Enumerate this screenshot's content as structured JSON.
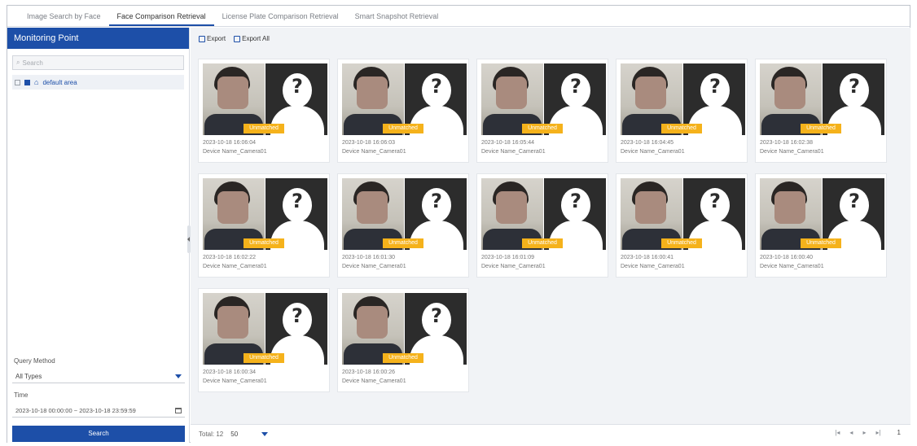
{
  "tabs": [
    {
      "label": "Image Search by Face"
    },
    {
      "label": "Face Comparison Retrieval"
    },
    {
      "label": "License Plate Comparison Retrieval"
    },
    {
      "label": "Smart Snapshot Retrieval"
    }
  ],
  "sidebar": {
    "title": "Monitoring Point",
    "search_placeholder": "Search",
    "tree_item": "default area",
    "query_method_label": "Query Method",
    "query_method_value": "All Types",
    "time_label": "Time",
    "time_range": "2023-10-18 00:00:00  ~  2023-10-18 23:59:59",
    "search_button": "Search"
  },
  "toolbar": {
    "export": "Export",
    "export_all": "Export All"
  },
  "badge_text": "Unmatched",
  "cards": [
    {
      "time": "2023-10-18 16:06:04",
      "device": "Device Name_Camera01"
    },
    {
      "time": "2023-10-18 16:06:03",
      "device": "Device Name_Camera01"
    },
    {
      "time": "2023-10-18 16:05:44",
      "device": "Device Name_Camera01"
    },
    {
      "time": "2023-10-18 16:04:45",
      "device": "Device Name_Camera01"
    },
    {
      "time": "2023-10-18 16:02:38",
      "device": "Device Name_Camera01"
    },
    {
      "time": "2023-10-18 16:02:22",
      "device": "Device Name_Camera01"
    },
    {
      "time": "2023-10-18 16:01:30",
      "device": "Device Name_Camera01"
    },
    {
      "time": "2023-10-18 16:01:09",
      "device": "Device Name_Camera01"
    },
    {
      "time": "2023-10-18 16:00:41",
      "device": "Device Name_Camera01"
    },
    {
      "time": "2023-10-18 16:00:40",
      "device": "Device Name_Camera01"
    },
    {
      "time": "2023-10-18 16:00:34",
      "device": "Device Name_Camera01"
    },
    {
      "time": "2023-10-18 16:00:26",
      "device": "Device Name_Camera01"
    }
  ],
  "footer": {
    "total": "Total: 12",
    "page_size": "50",
    "pager": {
      "first": "|◂",
      "prev": "◂",
      "next": "▸",
      "last": "▸|",
      "page": "1"
    }
  },
  "colors": {
    "accent": "#1d4fa8",
    "badge": "#f5b21b",
    "panel_bg": "#f1f3f6"
  }
}
